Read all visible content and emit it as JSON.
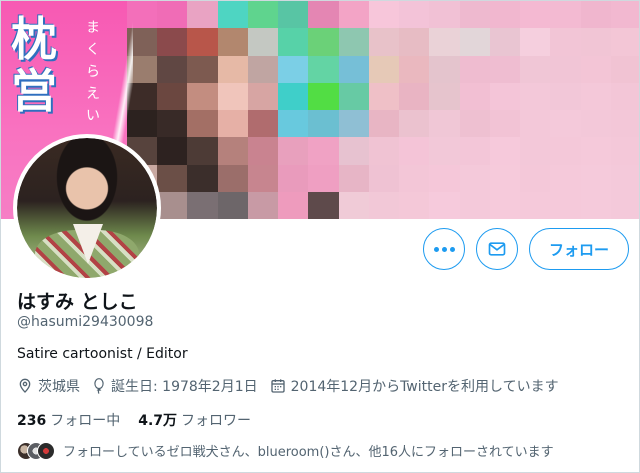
{
  "banner": {
    "title_chars": [
      "枕",
      "営"
    ],
    "ruby_chars": [
      "ま",
      "く",
      "ら",
      "え",
      "い"
    ],
    "mosaic_colors": [
      "#f36fba",
      "#f06cb6",
      "#e9a3c3",
      "#4ed5c2",
      "#5fd48e",
      "#58c5a4",
      "#e486b3",
      "#f3a4c6",
      "#f7c6da",
      "#f3c3d8",
      "#f1c1d5",
      "#eeb9cf",
      "#f1b7cf",
      "#f4b9d2",
      "#f3bad2",
      "#f0b6ce",
      "#f2b8d0",
      "#7f6158",
      "#8b4a4c",
      "#b8564a",
      "#b2876e",
      "#c4c8c2",
      "#57d2a8",
      "#6bd178",
      "#8ec7b0",
      "#e8c2c9",
      "#e7bcc4",
      "#ead2d7",
      "#e2d6d9",
      "#e9c5d2",
      "#f5cfde",
      "#f2c5d6",
      "#f1c5d5",
      "#f3c6d6",
      "#9a7d6e",
      "#604743",
      "#7d5a50",
      "#e6b9a6",
      "#c0a5a2",
      "#7bcfe6",
      "#63d4a4",
      "#76bfd7",
      "#e6c9b7",
      "#eab8bf",
      "#e4c4cd",
      "#efbcd0",
      "#efbdd1",
      "#f0c6d6",
      "#f1c5d6",
      "#f3c5d6",
      "#f1c3d3",
      "#3d2c28",
      "#6b4740",
      "#c38d80",
      "#f0c5bb",
      "#d7a5a3",
      "#3fcfc9",
      "#52dd44",
      "#67caa4",
      "#efc0c7",
      "#e9b4c3",
      "#e6c4cd",
      "#f2bfd3",
      "#f4c5d8",
      "#f3c8d9",
      "#f2c7d8",
      "#f4c8d9",
      "#f3c6d7",
      "#2c221f",
      "#382a27",
      "#a36f65",
      "#e6b0a6",
      "#b06c6e",
      "#68c9de",
      "#6bbfd1",
      "#8fbfd4",
      "#e8b5c4",
      "#ebc2cf",
      "#f0c7d6",
      "#eec0d1",
      "#f2c3d5",
      "#f3c8d9",
      "#f4c9da",
      "#f3c8d9",
      "#f3c7d8",
      "#57433d",
      "#2d2220",
      "#4d3b36",
      "#b5817c",
      "#c98390",
      "#e8a0bd",
      "#f0a2c4",
      "#e7c2d0",
      "#f0c3d3",
      "#f4c4d7",
      "#f2c8d8",
      "#f3c6d8",
      "#f6c9db",
      "#f3c8d9",
      "#f4c8d9",
      "#f5c9da",
      "#f4c8d9",
      "#c9a9a2",
      "#6b4f47",
      "#3b2e2b",
      "#9b6e6a",
      "#c7858f",
      "#e99bbc",
      "#ef9fc2",
      "#e7b5c6",
      "#efc2d3",
      "#f3c6d7",
      "#f5c7d9",
      "#f4c9da",
      "#f6cadb",
      "#f4c8d9",
      "#f5c9da",
      "#f5cadb",
      "#f4c9da",
      "#d8bfbf",
      "#a88f8e",
      "#7a6f73",
      "#6d6669",
      "#c89aa5",
      "#ee9bbd",
      "#5e4a4b",
      "#f0cbd7",
      "#f2c8d7",
      "#f4c8d8",
      "#f6cadc",
      "#f4c9da",
      "#f6cadb",
      "#f5c9da",
      "#f5c9da",
      "#f5cadb",
      "#f4c9da"
    ]
  },
  "profile": {
    "display_name": "はすみ としこ",
    "handle": "@hasumi29430098",
    "bio": "Satire cartoonist / Editor",
    "location": "茨城県",
    "birthday": "誕生日: 1978年2月1日",
    "joined": "2014年12月からTwitterを利用しています",
    "following_count": "236",
    "following_label": "フォロー中",
    "followers_count": "4.7万",
    "followers_label": "フォロワー",
    "followed_by": "フォローしているゼロ戦犬さん、blueroom()さん、他16人にフォローされています"
  },
  "actions": {
    "more_icon": "more-horizontal-icon",
    "message_icon": "mail-icon",
    "follow_label": "フォロー"
  },
  "colors": {
    "accent": "#1d9bf0",
    "secondary_text": "#536471"
  }
}
